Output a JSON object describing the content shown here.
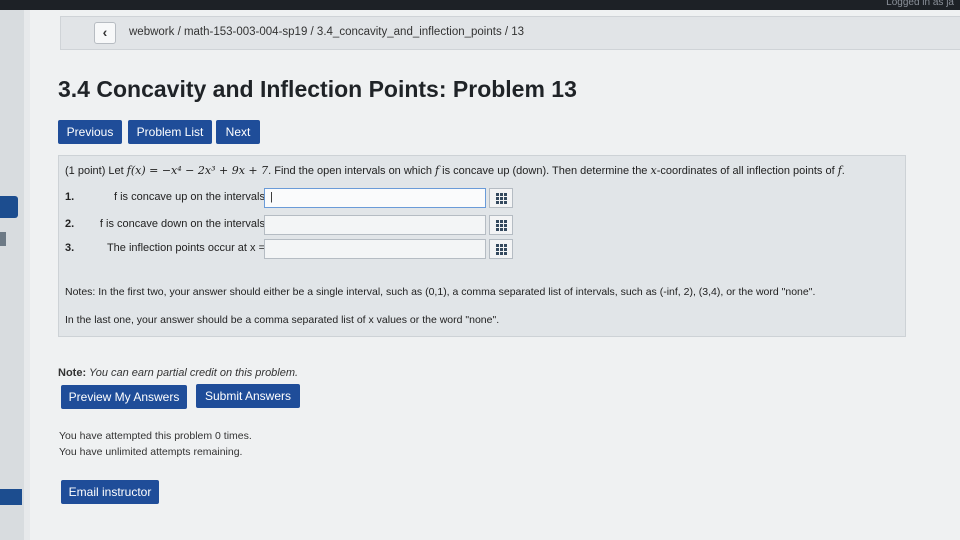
{
  "topbar": {
    "login_status": "Logged in as ja"
  },
  "breadcrumb": {
    "back_glyph": "‹",
    "path": "webwork / math-153-003-004-sp19 / 3.4_concavity_and_inflection_points / 13"
  },
  "title": "3.4 Concavity and Inflection Points: Problem 13",
  "nav": {
    "previous": "Previous",
    "problem_list": "Problem List",
    "next": "Next"
  },
  "problem": {
    "points": "(1 point) Let ",
    "func": "f(x) = −x⁴ − 2x³ + 9x + 7",
    "statement_rest": ". Find the open intervals on which ",
    "f_symbol": "f",
    "statement_end": " is concave up (down). Then determine the ",
    "x_symbol": "x",
    "statement_tail": "-coordinates of all inflection points of ",
    "f_end": "f",
    "period": ".",
    "questions": [
      {
        "num": "1.",
        "text": "f is concave up on the intervals",
        "value": "|"
      },
      {
        "num": "2.",
        "text": "f is concave down on the intervals",
        "value": ""
      },
      {
        "num": "3.",
        "text": "The inflection points occur at x =",
        "value": ""
      }
    ],
    "notes": "Notes: In the first two, your answer should either be a single interval, such as (0,1), a comma separated list of intervals, such as (-inf, 2), (3,4), or the word \"none\".",
    "notes_last": "In the last one, your answer should be a comma separated list of x values or the word \"none\"."
  },
  "partial_credit": {
    "label": "Note:",
    "text": " You can earn partial credit on this problem."
  },
  "actions": {
    "preview": "Preview My Answers",
    "submit": "Submit Answers"
  },
  "attempts": {
    "line1": "You have attempted this problem 0 times.",
    "line2": "You have unlimited attempts remaining."
  },
  "email_instructor": "Email instructor",
  "colors": {
    "button_blue": "#1f4d99",
    "page_bg": "#eff1f2"
  }
}
